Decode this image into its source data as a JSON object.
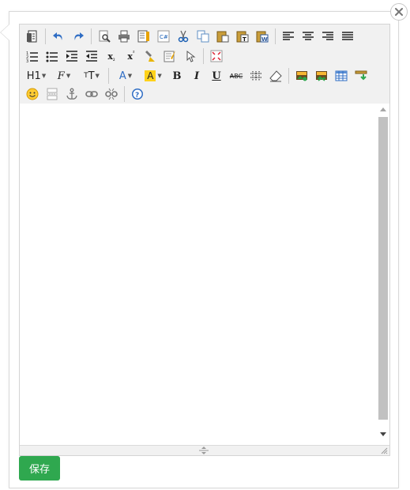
{
  "dialog": {
    "save_label": "保存",
    "close_icon": "close-icon"
  },
  "toolbar": {
    "row1": [
      "source-icon",
      "undo-icon",
      "redo-icon",
      "preview-icon",
      "print-icon",
      "template-icon",
      "code-icon",
      "cut-icon",
      "copy-icon",
      "paste-icon",
      "paste-text-icon",
      "paste-word-icon",
      "align-left-icon",
      "align-center-icon",
      "align-right-icon",
      "align-justify-icon"
    ],
    "row2": [
      "ordered-list-icon",
      "unordered-list-icon",
      "indent-icon",
      "outdent-icon",
      "subscript-icon",
      "superscript-icon",
      "format-brush-icon",
      "clear-format-icon",
      "select-all-icon",
      "fullscreen-icon"
    ],
    "row3": [
      "heading-dropdown",
      "font-family-dropdown",
      "font-size-dropdown",
      "font-color-dropdown",
      "highlight-color-dropdown",
      "bold-icon",
      "italic-icon",
      "underline-icon",
      "strikethrough-icon",
      "horizontal-rule-icon",
      "eraser-icon",
      "image-icon",
      "multi-image-icon",
      "table-icon",
      "insert-row-icon"
    ],
    "row4": [
      "emoticon-icon",
      "page-break-icon",
      "anchor-icon",
      "link-icon",
      "unlink-icon",
      "help-icon"
    ],
    "heading_label": "H1",
    "font_color_label": "A",
    "highlight_label": "A",
    "bold_label": "B",
    "italic_label": "I",
    "underline_label": "U",
    "strike_label": "ABC",
    "sub_label": "x",
    "sup_label": "x",
    "font_size_label": "T",
    "font_family_label": "F"
  },
  "colors": {
    "save_bg": "#2fa84f",
    "toolbar_bg": "#f1f1f1",
    "scroll_thumb": "#c1c1c1"
  }
}
